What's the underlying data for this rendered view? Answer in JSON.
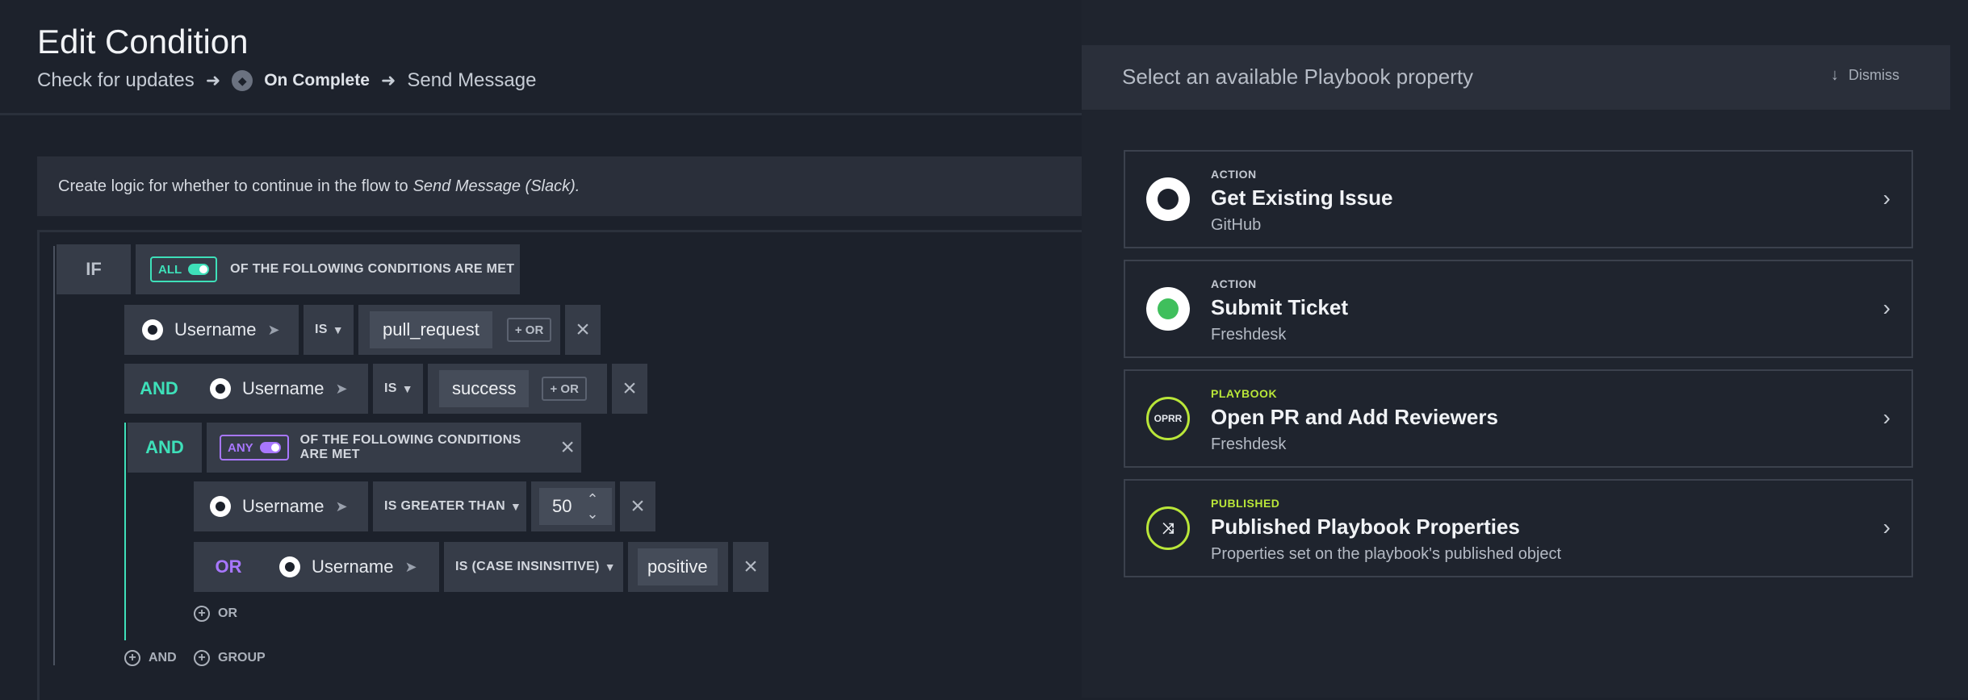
{
  "header": {
    "title": "Edit Condition",
    "breadcrumb": {
      "step1": "Check for updates",
      "step2": "On Complete",
      "step3": "Send Message"
    }
  },
  "banner": {
    "text": "Create logic for whether to continue in the flow to",
    "target": "Send Message (Slack)."
  },
  "builder": {
    "if_label": "IF",
    "all_pill": "ALL",
    "all_text": "OF THE FOLLOWING CONDITIONS ARE MET",
    "row1": {
      "field": "Username",
      "op": "IS",
      "value": "pull_request",
      "or_btn": "+ OR"
    },
    "row2": {
      "conj": "AND",
      "field": "Username",
      "op": "IS",
      "value": "success",
      "or_btn": "+ OR"
    },
    "group": {
      "conj": "AND",
      "pill": "ANY",
      "text": "OF THE FOLLOWING CONDITIONS ARE MET"
    },
    "row3": {
      "field": "Username",
      "op": "IS GREATER THAN",
      "value": "50"
    },
    "row4": {
      "conj": "OR",
      "field": "Username",
      "op": "IS (CASE INSINSITIVE)",
      "value": "positive"
    },
    "add_or": "OR",
    "add_and": "AND",
    "add_group": "GROUP"
  },
  "panel": {
    "title": "Select an available Playbook property",
    "dismiss": "Dismiss",
    "cards": [
      {
        "type": "ACTION",
        "name": "Get Existing Issue",
        "sub": "GitHub",
        "icon": "github-icon"
      },
      {
        "type": "ACTION",
        "name": "Submit Ticket",
        "sub": "Freshdesk",
        "icon": "freshdesk-icon"
      },
      {
        "type": "PLAYBOOK",
        "name": "Open PR and Add Reviewers",
        "sub": "Freshdesk",
        "icon": "OPRR"
      },
      {
        "type": "PUBLISHED",
        "name": "Published Playbook Properties",
        "sub": "Properties set on the playbook's published object",
        "icon": "published-icon"
      }
    ]
  },
  "colors": {
    "accent_teal": "#3ee0b9",
    "accent_purple": "#a877ff",
    "accent_lime": "#b9e639"
  }
}
